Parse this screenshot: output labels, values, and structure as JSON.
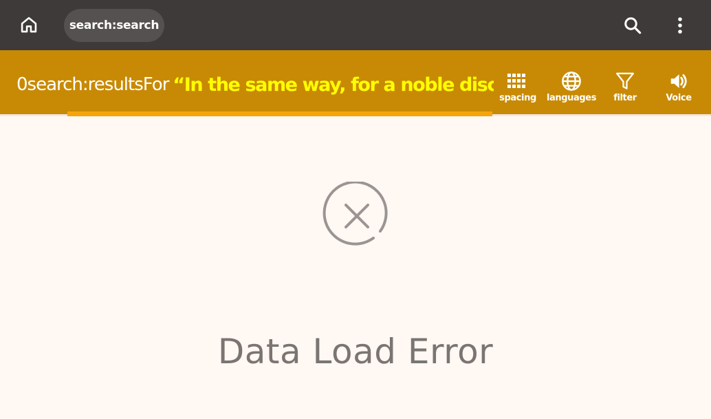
{
  "topbar": {
    "home_icon": "home-icon",
    "search_chip_label": "search:search",
    "search_icon": "search-icon",
    "more_icon": "more-vertical-icon"
  },
  "results": {
    "count": "0",
    "label": "search:resultsFor",
    "query": "“In the same way, for a noble discipl",
    "progress_fraction": 0.6
  },
  "toolbar": {
    "spacing": {
      "label": "spacing",
      "icon": "grid-icon"
    },
    "languages": {
      "label": "languages",
      "icon": "globe-icon"
    },
    "filter": {
      "label": "filter",
      "icon": "filter-icon"
    },
    "voice": {
      "label": "Voice",
      "icon": "speaker-icon"
    }
  },
  "error": {
    "icon": "error-circle-x-icon",
    "title": "Data Load Error"
  },
  "colors": {
    "topbar_bg": "#3e3a39",
    "subbar_bg": "#c88a05",
    "progress": "#f5a50b",
    "query_text": "#ffff00",
    "page_bg": "#fff8f3",
    "error_gray": "#9a9593"
  }
}
